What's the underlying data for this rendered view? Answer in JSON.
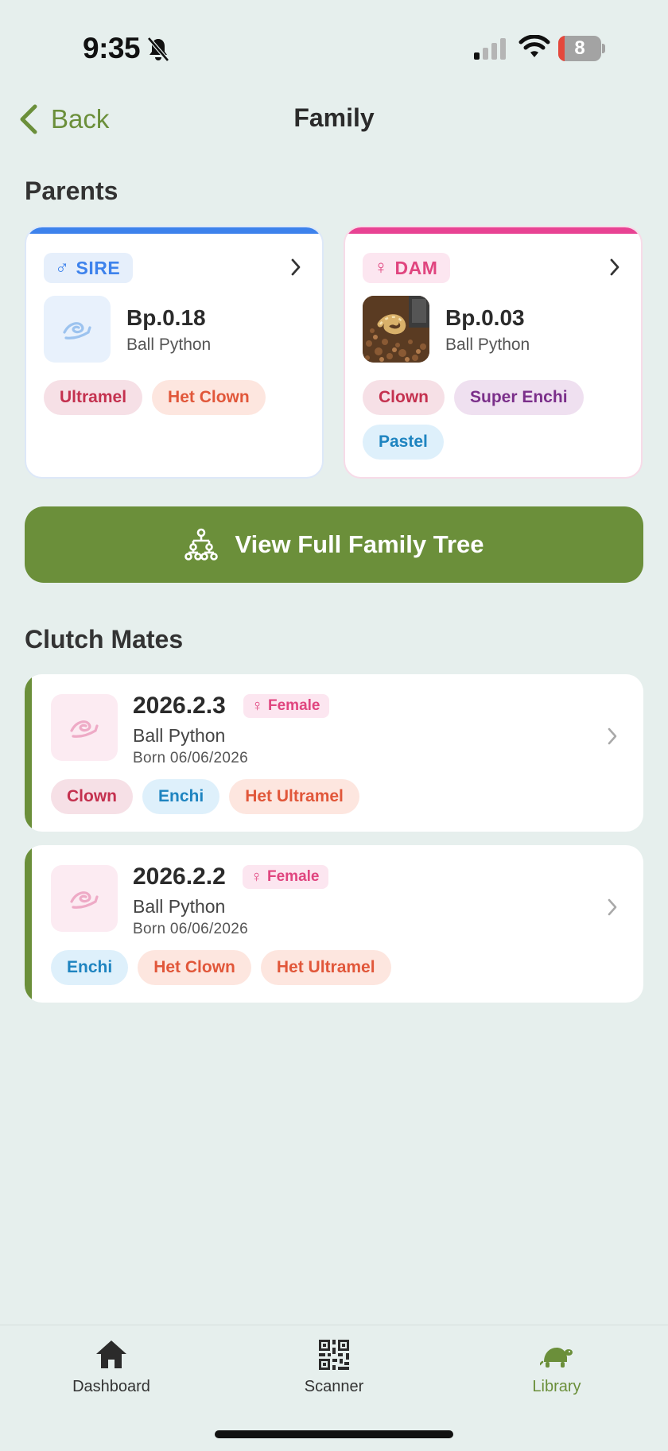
{
  "status_bar": {
    "time": "9:35",
    "battery": "8"
  },
  "nav": {
    "back_label": "Back",
    "title": "Family"
  },
  "parents_section": {
    "title": "Parents"
  },
  "sire": {
    "sex_label": "SIRE",
    "sex_symbol": "♂",
    "name": "Bp.0.18",
    "species": "Ball Python",
    "traits": [
      "Ultramel",
      "Het Clown"
    ],
    "accent_color": "#3d82ec"
  },
  "dam": {
    "sex_label": "DAM",
    "sex_symbol": "♀",
    "name": "Bp.0.03",
    "species": "Ball Python",
    "traits": [
      "Clown",
      "Super Enchi",
      "Pastel"
    ],
    "accent_color": "#e84393"
  },
  "tree_button": {
    "label": "View Full Family Tree"
  },
  "clutch_section": {
    "title": "Clutch Mates"
  },
  "clutch_mates": [
    {
      "name": "2026.2.3",
      "sex": "Female",
      "species": "Ball Python",
      "born": "Born 06/06/2026",
      "traits": [
        "Clown",
        "Enchi",
        "Het Ultramel"
      ]
    },
    {
      "name": "2026.2.2",
      "sex": "Female",
      "species": "Ball Python",
      "born": "Born 06/06/2026",
      "traits": [
        "Enchi",
        "Het Clown",
        "Het Ultramel"
      ]
    }
  ],
  "tab_bar": {
    "tabs": [
      {
        "label": "Dashboard",
        "icon": "home-icon"
      },
      {
        "label": "Scanner",
        "icon": "qr-code-icon"
      },
      {
        "label": "Library",
        "icon": "turtle-icon",
        "active": true
      }
    ]
  },
  "colors": {
    "brand_green": "#6b8f3a",
    "female_pink": "#e0457f",
    "male_blue": "#3d82ec"
  }
}
